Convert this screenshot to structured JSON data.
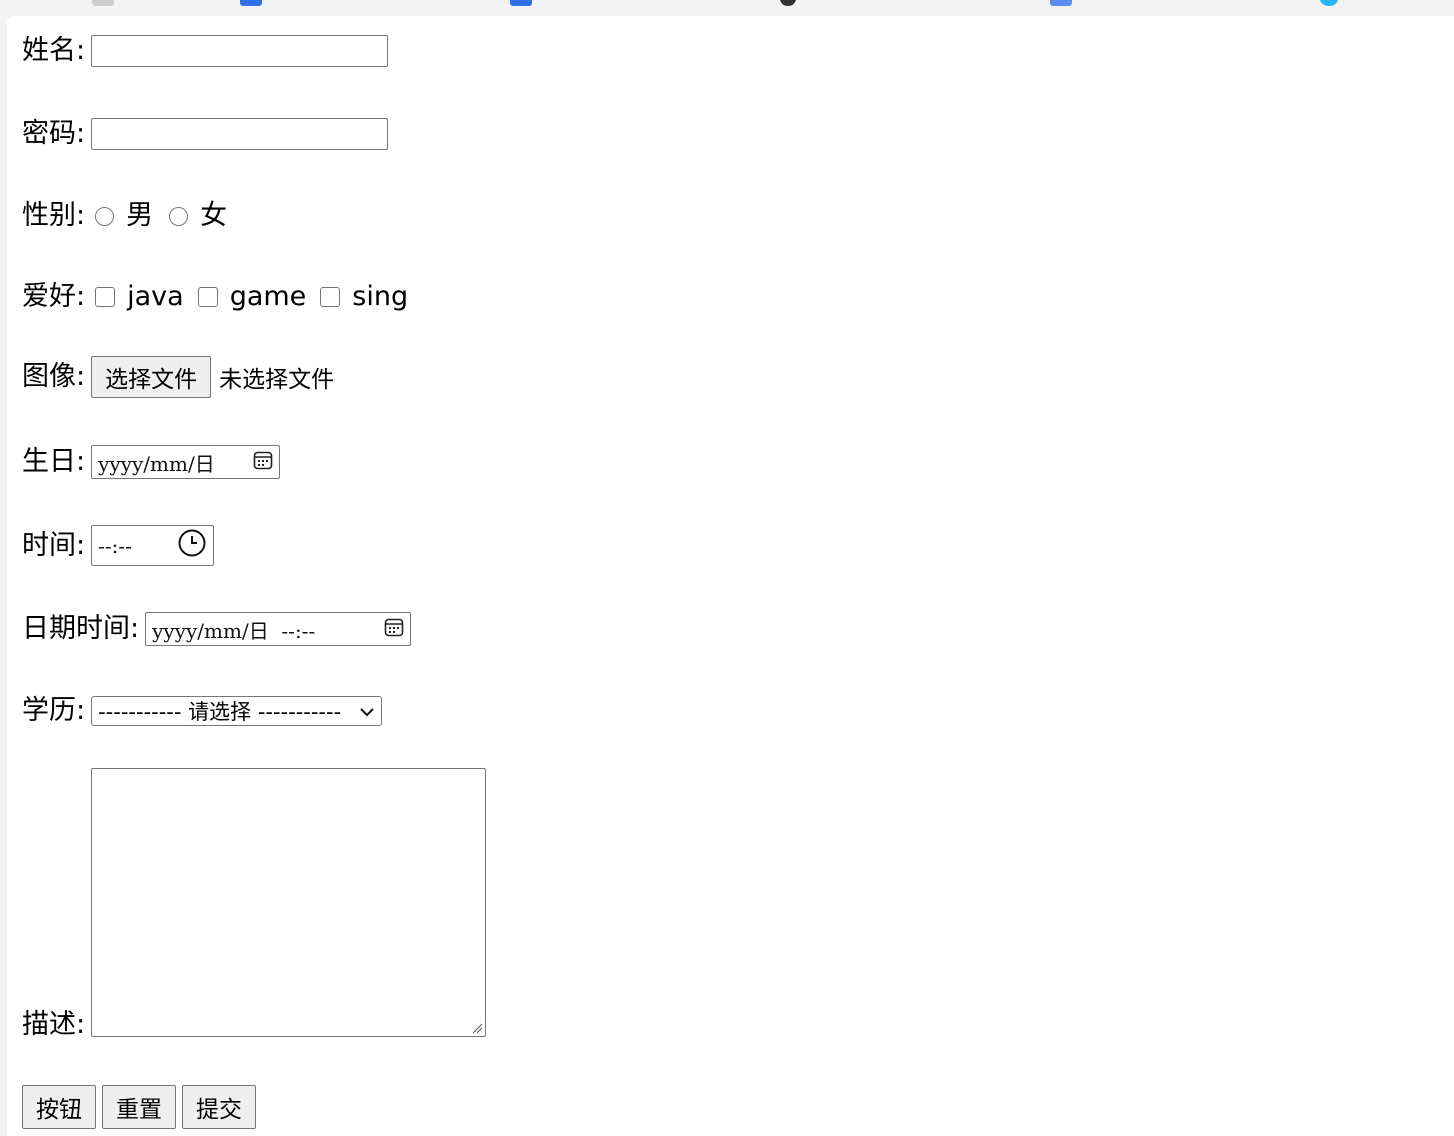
{
  "form": {
    "name_label": "姓名:",
    "name_value": "",
    "password_label": "密码:",
    "password_value": "",
    "gender_label": "性别:",
    "gender_options": [
      "男",
      "女"
    ],
    "hobby_label": "爱好:",
    "hobby_options": [
      "java",
      "game",
      "sing"
    ],
    "image_label": "图像:",
    "file_button": "选择文件",
    "file_status": "未选择文件",
    "birthday_label": "生日:",
    "birthday_placeholder": "yyyy/mm/日",
    "time_label": "时间:",
    "time_placeholder": "--:--",
    "datetime_label": "日期时间:",
    "datetime_placeholder": "yyyy/mm/日  --:--",
    "education_label": "学历:",
    "education_selected": "----------- 请选择 -----------",
    "description_label": "描述:",
    "description_value": "",
    "buttons": [
      "按钮",
      "重置",
      "提交"
    ]
  },
  "icons": {
    "calendar": "calendar-icon",
    "clock": "clock-icon",
    "dropdown": "chevron-down-icon",
    "resize": "resize-handle-icon"
  },
  "colors": {
    "border": "#767676",
    "button_bg": "#efefef",
    "page_bg": "#ffffff",
    "browser_bg": "#f1f3f4"
  }
}
